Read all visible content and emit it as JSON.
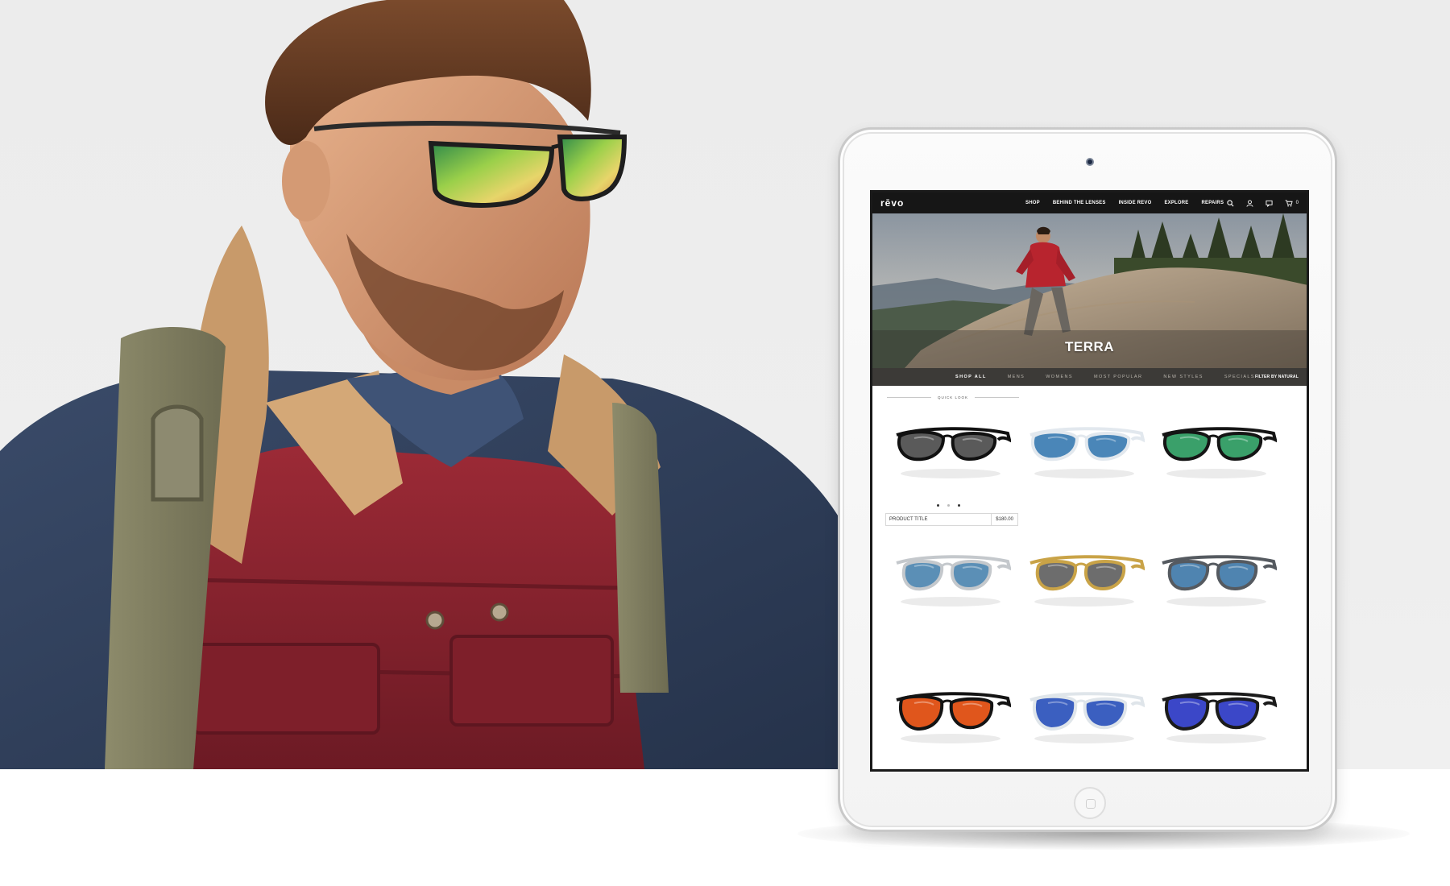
{
  "site": {
    "logo": "rēvo",
    "nav": [
      "SHOP",
      "BEHIND THE LENSES",
      "INSIDE REVO",
      "EXPLORE",
      "REPAIRS"
    ],
    "cart_count": "0",
    "icons": [
      "search-icon",
      "account-icon",
      "chat-icon",
      "cart-icon"
    ]
  },
  "banner": {
    "title": "TERRA"
  },
  "filters": {
    "tabs": [
      "SHOP ALL",
      "MENS",
      "WOMENS",
      "MOST POPULAR",
      "NEW STYLES",
      "SPECIALS"
    ],
    "active": "SHOP ALL",
    "filter_by": "FILTER BY NATURAL"
  },
  "quick_look": "QUICK LOOK",
  "featured_product": {
    "title": "PRODUCT TITLE",
    "price": "$180.00"
  },
  "products": [
    {
      "frame": "#111111",
      "lens": "#5a5a5a",
      "style": "wrap"
    },
    {
      "frame": "#e2e8ee",
      "lens": "#4a86b8",
      "style": "wrap"
    },
    {
      "frame": "#151515",
      "lens": "#3aa06a",
      "style": "wrap"
    },
    {
      "frame": "#c4c8cc",
      "lens": "#5b8fb6",
      "style": "aviator"
    },
    {
      "frame": "#c9a347",
      "lens": "#6d6d6d",
      "style": "aviator"
    },
    {
      "frame": "#555a60",
      "lens": "#4f84b0",
      "style": "aviator"
    },
    {
      "frame": "#141414",
      "lens": "#e0561c",
      "style": "round"
    },
    {
      "frame": "#dfe5ea",
      "lens": "#3b5fc0",
      "style": "round"
    },
    {
      "frame": "#1b1b1b",
      "lens": "#3b47c8",
      "style": "round"
    }
  ],
  "colors": {
    "nav_bg": "#161616",
    "filter_bar_bg": "#3c3a37",
    "jacket_red": "#8c2530",
    "denim": "#34445f"
  }
}
